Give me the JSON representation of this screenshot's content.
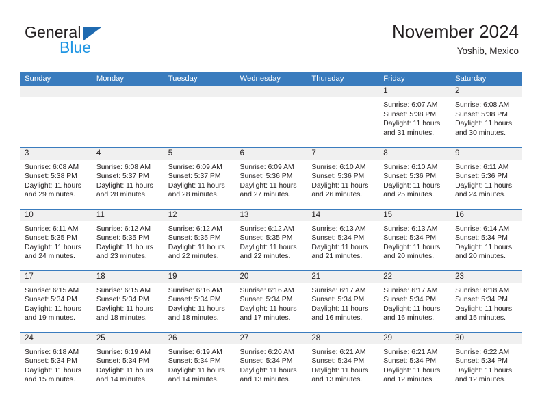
{
  "brand": {
    "name_part1": "General",
    "name_part2": "Blue",
    "triangle_icon": "blue-triangle-icon",
    "accent_dark": "#1f6ab0",
    "accent_light": "#2196e3"
  },
  "header": {
    "title": "November 2024",
    "subtitle": "Yoshib, Mexico"
  },
  "theme": {
    "header_bg": "#3a7cbe",
    "daynum_bg": "#f0f0f0",
    "grid_line": "#3a7cbe",
    "text": "#231f20"
  },
  "weekday_headers": [
    "Sunday",
    "Monday",
    "Tuesday",
    "Wednesday",
    "Thursday",
    "Friday",
    "Saturday"
  ],
  "weeks": [
    [
      {
        "day": "",
        "empty": true,
        "sunrise": "",
        "sunset": "",
        "daylight_line1": "",
        "daylight_line2": ""
      },
      {
        "day": "",
        "empty": true,
        "sunrise": "",
        "sunset": "",
        "daylight_line1": "",
        "daylight_line2": ""
      },
      {
        "day": "",
        "empty": true,
        "sunrise": "",
        "sunset": "",
        "daylight_line1": "",
        "daylight_line2": ""
      },
      {
        "day": "",
        "empty": true,
        "sunrise": "",
        "sunset": "",
        "daylight_line1": "",
        "daylight_line2": ""
      },
      {
        "day": "",
        "empty": true,
        "sunrise": "",
        "sunset": "",
        "daylight_line1": "",
        "daylight_line2": ""
      },
      {
        "day": "1",
        "empty": false,
        "sunrise": "Sunrise: 6:07 AM",
        "sunset": "Sunset: 5:38 PM",
        "daylight_line1": "Daylight: 11 hours",
        "daylight_line2": "and 31 minutes."
      },
      {
        "day": "2",
        "empty": false,
        "sunrise": "Sunrise: 6:08 AM",
        "sunset": "Sunset: 5:38 PM",
        "daylight_line1": "Daylight: 11 hours",
        "daylight_line2": "and 30 minutes."
      }
    ],
    [
      {
        "day": "3",
        "empty": false,
        "sunrise": "Sunrise: 6:08 AM",
        "sunset": "Sunset: 5:38 PM",
        "daylight_line1": "Daylight: 11 hours",
        "daylight_line2": "and 29 minutes."
      },
      {
        "day": "4",
        "empty": false,
        "sunrise": "Sunrise: 6:08 AM",
        "sunset": "Sunset: 5:37 PM",
        "daylight_line1": "Daylight: 11 hours",
        "daylight_line2": "and 28 minutes."
      },
      {
        "day": "5",
        "empty": false,
        "sunrise": "Sunrise: 6:09 AM",
        "sunset": "Sunset: 5:37 PM",
        "daylight_line1": "Daylight: 11 hours",
        "daylight_line2": "and 28 minutes."
      },
      {
        "day": "6",
        "empty": false,
        "sunrise": "Sunrise: 6:09 AM",
        "sunset": "Sunset: 5:36 PM",
        "daylight_line1": "Daylight: 11 hours",
        "daylight_line2": "and 27 minutes."
      },
      {
        "day": "7",
        "empty": false,
        "sunrise": "Sunrise: 6:10 AM",
        "sunset": "Sunset: 5:36 PM",
        "daylight_line1": "Daylight: 11 hours",
        "daylight_line2": "and 26 minutes."
      },
      {
        "day": "8",
        "empty": false,
        "sunrise": "Sunrise: 6:10 AM",
        "sunset": "Sunset: 5:36 PM",
        "daylight_line1": "Daylight: 11 hours",
        "daylight_line2": "and 25 minutes."
      },
      {
        "day": "9",
        "empty": false,
        "sunrise": "Sunrise: 6:11 AM",
        "sunset": "Sunset: 5:36 PM",
        "daylight_line1": "Daylight: 11 hours",
        "daylight_line2": "and 24 minutes."
      }
    ],
    [
      {
        "day": "10",
        "empty": false,
        "sunrise": "Sunrise: 6:11 AM",
        "sunset": "Sunset: 5:35 PM",
        "daylight_line1": "Daylight: 11 hours",
        "daylight_line2": "and 24 minutes."
      },
      {
        "day": "11",
        "empty": false,
        "sunrise": "Sunrise: 6:12 AM",
        "sunset": "Sunset: 5:35 PM",
        "daylight_line1": "Daylight: 11 hours",
        "daylight_line2": "and 23 minutes."
      },
      {
        "day": "12",
        "empty": false,
        "sunrise": "Sunrise: 6:12 AM",
        "sunset": "Sunset: 5:35 PM",
        "daylight_line1": "Daylight: 11 hours",
        "daylight_line2": "and 22 minutes."
      },
      {
        "day": "13",
        "empty": false,
        "sunrise": "Sunrise: 6:12 AM",
        "sunset": "Sunset: 5:35 PM",
        "daylight_line1": "Daylight: 11 hours",
        "daylight_line2": "and 22 minutes."
      },
      {
        "day": "14",
        "empty": false,
        "sunrise": "Sunrise: 6:13 AM",
        "sunset": "Sunset: 5:34 PM",
        "daylight_line1": "Daylight: 11 hours",
        "daylight_line2": "and 21 minutes."
      },
      {
        "day": "15",
        "empty": false,
        "sunrise": "Sunrise: 6:13 AM",
        "sunset": "Sunset: 5:34 PM",
        "daylight_line1": "Daylight: 11 hours",
        "daylight_line2": "and 20 minutes."
      },
      {
        "day": "16",
        "empty": false,
        "sunrise": "Sunrise: 6:14 AM",
        "sunset": "Sunset: 5:34 PM",
        "daylight_line1": "Daylight: 11 hours",
        "daylight_line2": "and 20 minutes."
      }
    ],
    [
      {
        "day": "17",
        "empty": false,
        "sunrise": "Sunrise: 6:15 AM",
        "sunset": "Sunset: 5:34 PM",
        "daylight_line1": "Daylight: 11 hours",
        "daylight_line2": "and 19 minutes."
      },
      {
        "day": "18",
        "empty": false,
        "sunrise": "Sunrise: 6:15 AM",
        "sunset": "Sunset: 5:34 PM",
        "daylight_line1": "Daylight: 11 hours",
        "daylight_line2": "and 18 minutes."
      },
      {
        "day": "19",
        "empty": false,
        "sunrise": "Sunrise: 6:16 AM",
        "sunset": "Sunset: 5:34 PM",
        "daylight_line1": "Daylight: 11 hours",
        "daylight_line2": "and 18 minutes."
      },
      {
        "day": "20",
        "empty": false,
        "sunrise": "Sunrise: 6:16 AM",
        "sunset": "Sunset: 5:34 PM",
        "daylight_line1": "Daylight: 11 hours",
        "daylight_line2": "and 17 minutes."
      },
      {
        "day": "21",
        "empty": false,
        "sunrise": "Sunrise: 6:17 AM",
        "sunset": "Sunset: 5:34 PM",
        "daylight_line1": "Daylight: 11 hours",
        "daylight_line2": "and 16 minutes."
      },
      {
        "day": "22",
        "empty": false,
        "sunrise": "Sunrise: 6:17 AM",
        "sunset": "Sunset: 5:34 PM",
        "daylight_line1": "Daylight: 11 hours",
        "daylight_line2": "and 16 minutes."
      },
      {
        "day": "23",
        "empty": false,
        "sunrise": "Sunrise: 6:18 AM",
        "sunset": "Sunset: 5:34 PM",
        "daylight_line1": "Daylight: 11 hours",
        "daylight_line2": "and 15 minutes."
      }
    ],
    [
      {
        "day": "24",
        "empty": false,
        "sunrise": "Sunrise: 6:18 AM",
        "sunset": "Sunset: 5:34 PM",
        "daylight_line1": "Daylight: 11 hours",
        "daylight_line2": "and 15 minutes."
      },
      {
        "day": "25",
        "empty": false,
        "sunrise": "Sunrise: 6:19 AM",
        "sunset": "Sunset: 5:34 PM",
        "daylight_line1": "Daylight: 11 hours",
        "daylight_line2": "and 14 minutes."
      },
      {
        "day": "26",
        "empty": false,
        "sunrise": "Sunrise: 6:19 AM",
        "sunset": "Sunset: 5:34 PM",
        "daylight_line1": "Daylight: 11 hours",
        "daylight_line2": "and 14 minutes."
      },
      {
        "day": "27",
        "empty": false,
        "sunrise": "Sunrise: 6:20 AM",
        "sunset": "Sunset: 5:34 PM",
        "daylight_line1": "Daylight: 11 hours",
        "daylight_line2": "and 13 minutes."
      },
      {
        "day": "28",
        "empty": false,
        "sunrise": "Sunrise: 6:21 AM",
        "sunset": "Sunset: 5:34 PM",
        "daylight_line1": "Daylight: 11 hours",
        "daylight_line2": "and 13 minutes."
      },
      {
        "day": "29",
        "empty": false,
        "sunrise": "Sunrise: 6:21 AM",
        "sunset": "Sunset: 5:34 PM",
        "daylight_line1": "Daylight: 11 hours",
        "daylight_line2": "and 12 minutes."
      },
      {
        "day": "30",
        "empty": false,
        "sunrise": "Sunrise: 6:22 AM",
        "sunset": "Sunset: 5:34 PM",
        "daylight_line1": "Daylight: 11 hours",
        "daylight_line2": "and 12 minutes."
      }
    ]
  ]
}
